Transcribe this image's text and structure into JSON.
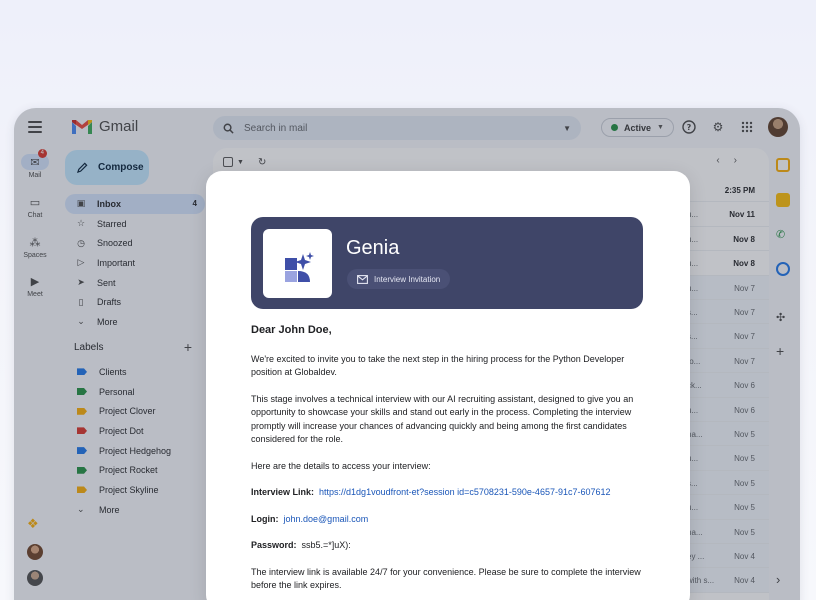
{
  "app": {
    "name": "Gmail"
  },
  "search": {
    "placeholder": "Search in mail"
  },
  "status": {
    "label": "Active",
    "color": "#1e8e3e"
  },
  "rail": [
    {
      "label": "Mail",
      "icon": "mail-icon",
      "badge": "4"
    },
    {
      "label": "Chat",
      "icon": "chat-icon"
    },
    {
      "label": "Spaces",
      "icon": "spaces-icon"
    },
    {
      "label": "Meet",
      "icon": "meet-icon"
    }
  ],
  "compose": {
    "label": "Compose"
  },
  "nav": [
    {
      "label": "Inbox",
      "count": "4",
      "icon": "inbox-icon"
    },
    {
      "label": "Starred",
      "icon": "star-icon"
    },
    {
      "label": "Snoozed",
      "icon": "clock-icon"
    },
    {
      "label": "Important",
      "icon": "important-icon"
    },
    {
      "label": "Sent",
      "icon": "send-icon"
    },
    {
      "label": "Drafts",
      "icon": "draft-icon"
    },
    {
      "label": "More",
      "icon": "chevron-down-icon"
    }
  ],
  "labels": {
    "title": "Labels",
    "items": [
      {
        "label": "Clients",
        "color": "#1a73e8"
      },
      {
        "label": "Personal",
        "color": "#1e8e3e"
      },
      {
        "label": "Project Clover",
        "color": "#f9ab00"
      },
      {
        "label": "Project Dot",
        "color": "#d93025"
      },
      {
        "label": "Project Hedgehog",
        "color": "#1a73e8"
      },
      {
        "label": "Project Rocket",
        "color": "#1e8e3e"
      },
      {
        "label": "Project Skyline",
        "color": "#f9ab00"
      }
    ],
    "more": "More"
  },
  "rows": [
    {
      "snip": "",
      "date": "2:35 PM",
      "unread": true
    },
    {
      "snip": "u...",
      "date": "Nov 11",
      "unread": true
    },
    {
      "snip": "u...",
      "date": "Nov 8",
      "unread": true
    },
    {
      "snip": "u...",
      "date": "Nov 8",
      "unread": true
    },
    {
      "snip": "u...",
      "date": "Nov 7",
      "unread": false
    },
    {
      "snip": "s...",
      "date": "Nov 7",
      "unread": false
    },
    {
      "snip": "s...",
      "date": "Nov 7",
      "unread": false
    },
    {
      "snip": "to...",
      "date": "Nov 7",
      "unread": false
    },
    {
      "snip": "ck...",
      "date": "Nov 6",
      "unread": false
    },
    {
      "snip": "u...",
      "date": "Nov 6",
      "unread": false
    },
    {
      "snip": "na...",
      "date": "Nov 5",
      "unread": false
    },
    {
      "snip": "u...",
      "date": "Nov 5",
      "unread": false
    },
    {
      "snip": "s...",
      "date": "Nov 5",
      "unread": false
    },
    {
      "snip": "u...",
      "date": "Nov 5",
      "unread": false
    },
    {
      "snip": "na...",
      "date": "Nov 5",
      "unread": false
    },
    {
      "snip": "ey ...",
      "date": "Nov 4",
      "unread": false
    },
    {
      "snip": "with s...",
      "date": "Nov 4",
      "unread": false
    }
  ],
  "email": {
    "brand": "Genia",
    "tag": "Interview Invitation",
    "greeting": "Dear John Doe,",
    "p1": "We're excited to invite you to take the next step in the hiring process for the Python Developer position at Globaldev.",
    "p2": "This stage involves a technical interview with our AI recruiting assistant, designed to give you an opportunity to showcase your skills and stand out early in the process. Completing the interview promptly will increase your chances of advancing quickly and being among the first candidates considered for the role.",
    "p3": "Here are the details to access your interview:",
    "link_label": "Interview Link:",
    "link_value": "https://d1dg1voudfront-et?session id=c5708231-590e-4657-91c7-607612",
    "login_label": "Login:",
    "login_value": "john.doe@gmail.com",
    "password_label": "Password:",
    "password_value": "ssb5.=*]uX):",
    "p4": "The interview link is available 24/7 for your convenience. Please be sure to complete the interview before the link expires."
  }
}
